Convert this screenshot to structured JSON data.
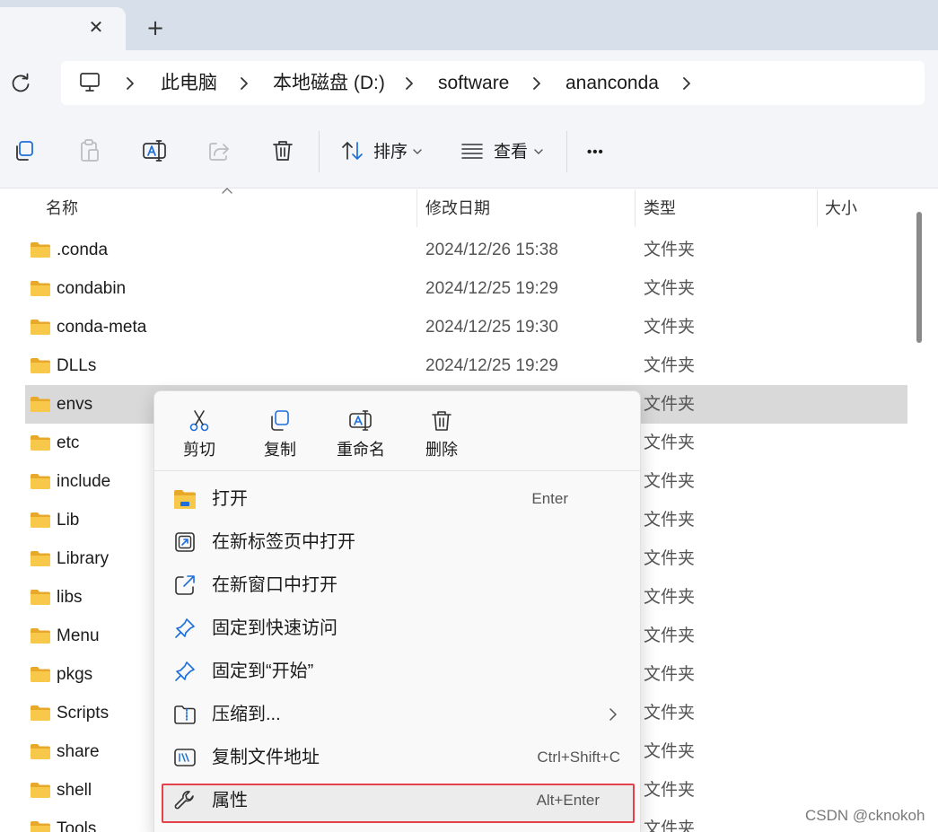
{
  "tab": {
    "close_glyph": "✕",
    "add_glyph": "+"
  },
  "address": {
    "breadcrumbs": [
      "此电脑",
      "本地磁盘 (D:)",
      "software",
      "ananconda"
    ]
  },
  "toolbar": {
    "sort_label": "排序",
    "view_label": "查看",
    "more_label": "•••"
  },
  "columns": {
    "name": "名称",
    "modified": "修改日期",
    "type": "类型",
    "size": "大小"
  },
  "files": [
    {
      "name": ".conda",
      "modified": "2024/12/26 15:38",
      "type": "文件夹"
    },
    {
      "name": "condabin",
      "modified": "2024/12/25 19:29",
      "type": "文件夹"
    },
    {
      "name": "conda-meta",
      "modified": "2024/12/25 19:30",
      "type": "文件夹"
    },
    {
      "name": "DLLs",
      "modified": "2024/12/25 19:29",
      "type": "文件夹"
    },
    {
      "name": "envs",
      "modified": "",
      "type": "文件夹",
      "selected": true
    },
    {
      "name": "etc",
      "modified": "",
      "type": "文件夹"
    },
    {
      "name": "include",
      "modified": "",
      "type": "文件夹"
    },
    {
      "name": "Lib",
      "modified": "",
      "type": "文件夹"
    },
    {
      "name": "Library",
      "modified": "",
      "type": "文件夹"
    },
    {
      "name": "libs",
      "modified": "",
      "type": "文件夹"
    },
    {
      "name": "Menu",
      "modified": "",
      "type": "文件夹"
    },
    {
      "name": "pkgs",
      "modified": "",
      "type": "文件夹"
    },
    {
      "name": "Scripts",
      "modified": "",
      "type": "文件夹"
    },
    {
      "name": "share",
      "modified": "",
      "type": "文件夹"
    },
    {
      "name": "shell",
      "modified": "",
      "type": "文件夹"
    },
    {
      "name": "Tools",
      "modified": "",
      "type": "文件夹"
    }
  ],
  "context_menu": {
    "quick_actions": [
      {
        "label": "剪切",
        "icon": "scissors-icon"
      },
      {
        "label": "复制",
        "icon": "copy-icon"
      },
      {
        "label": "重命名",
        "icon": "rename-icon"
      },
      {
        "label": "删除",
        "icon": "trash-icon"
      }
    ],
    "items": [
      {
        "label": "打开",
        "shortcut": "Enter",
        "icon": "folder-open-icon"
      },
      {
        "label": "在新标签页中打开",
        "shortcut": "",
        "icon": "new-tab-icon"
      },
      {
        "label": "在新窗口中打开",
        "shortcut": "",
        "icon": "new-window-icon"
      },
      {
        "label": "固定到快速访问",
        "shortcut": "",
        "icon": "pin-icon"
      },
      {
        "label": "固定到“开始”",
        "shortcut": "",
        "icon": "pin-icon"
      },
      {
        "label": "压缩到...",
        "shortcut": "",
        "icon": "zip-folder-icon",
        "submenu": true
      },
      {
        "label": "复制文件地址",
        "shortcut": "Ctrl+Shift+C",
        "icon": "copy-path-icon"
      },
      {
        "label": "属性",
        "shortcut": "Alt+Enter",
        "icon": "wrench-icon",
        "highlighted": true
      }
    ]
  },
  "watermark": "CSDN @cknokoh",
  "colors": {
    "highlight_border": "#e5414b",
    "folder_yellow": "#f6c244",
    "accent_blue": "#1e6fd9"
  }
}
